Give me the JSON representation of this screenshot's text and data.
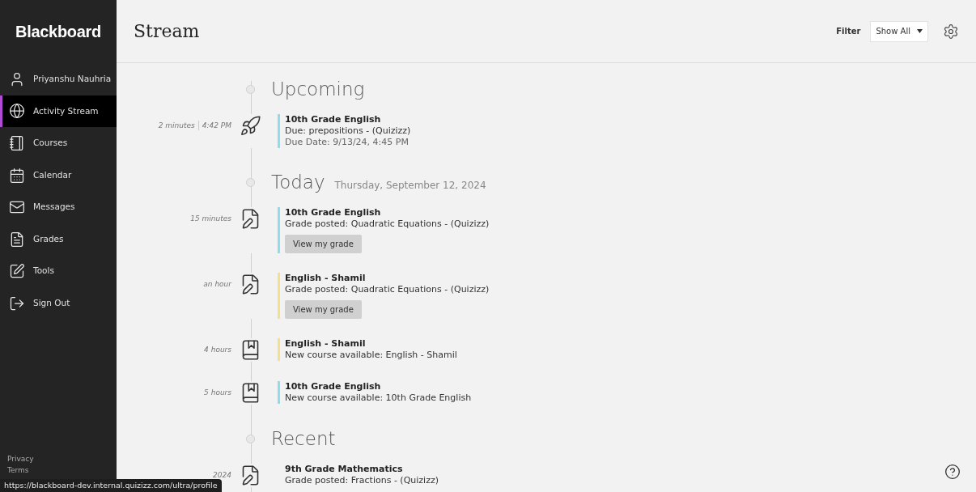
{
  "sidebar": {
    "logo": "Blackboard",
    "items": [
      {
        "label": "Priyanshu Nauhria",
        "selected": false
      },
      {
        "label": "Activity Stream",
        "selected": true
      },
      {
        "label": "Courses",
        "selected": false
      },
      {
        "label": "Calendar",
        "selected": false
      },
      {
        "label": "Messages",
        "selected": false
      },
      {
        "label": "Grades",
        "selected": false
      },
      {
        "label": "Tools",
        "selected": false
      },
      {
        "label": "Sign Out",
        "selected": false
      }
    ],
    "footer_links": [
      "Privacy",
      "Terms"
    ]
  },
  "header": {
    "title": "Stream",
    "filter_label": "Filter",
    "filter_value": "Show All"
  },
  "sections": [
    {
      "title": "Upcoming",
      "items": [
        {
          "kind": "due",
          "time": "2 minutes",
          "time_detail": "4:42 PM",
          "course": "10th Grade English",
          "text": "Due: prepositions - (Quizizz)",
          "detail": "Due Date: 9/13/24, 4:45 PM",
          "color": "#8fdcec"
        }
      ]
    },
    {
      "title": "Today",
      "date": "Thursday, September 12, 2024",
      "items": [
        {
          "kind": "grade",
          "time": "15 minutes",
          "course": "10th Grade English",
          "text": "Grade posted: Quadratic Equations - (Quizizz)",
          "button": "View my grade",
          "color": "#8fdcec"
        },
        {
          "kind": "grade",
          "time": "an hour",
          "course": "English - Shamil",
          "text": "Grade posted: Quadratic Equations - (Quizizz)",
          "button": "View my grade",
          "color": "#f3e08a"
        },
        {
          "kind": "course",
          "time": "4 hours",
          "course": "English - Shamil",
          "text": "New course available: English - Shamil",
          "color": "#f3e08a"
        },
        {
          "kind": "course",
          "time": "5 hours",
          "course": "10th Grade English",
          "text": "New course available: 10th Grade English",
          "color": "#8fdcec"
        }
      ]
    },
    {
      "title": "Recent",
      "items": [
        {
          "kind": "grade",
          "time": "2024",
          "course": "9th Grade Mathematics",
          "text": "Grade posted: Fractions - (Quizizz)"
        }
      ]
    }
  ],
  "status_url": "https://blackboard-dev.internal.quizizz.com/ultra/profile"
}
